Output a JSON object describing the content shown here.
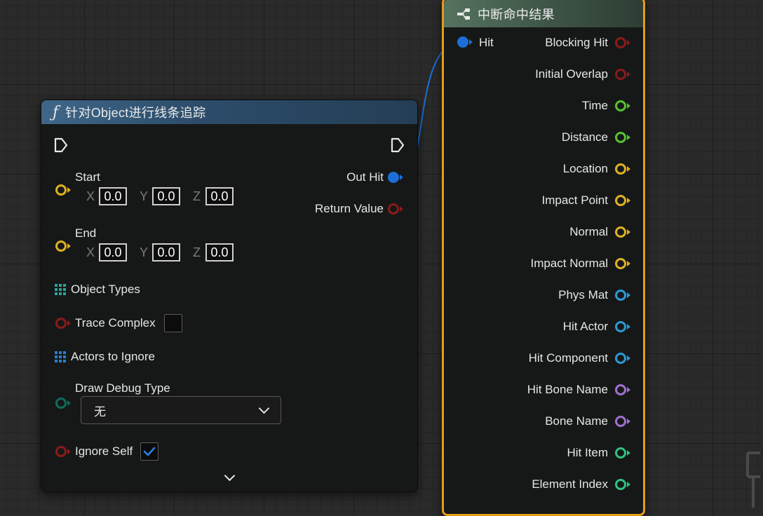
{
  "trace_node": {
    "icon": "function-icon",
    "icon_glyph": "ƒ",
    "title": "针对Object进行线条追踪",
    "pins": {
      "start": {
        "label": "Start",
        "x": "0.0",
        "y": "0.0",
        "z": "0.0",
        "color": "#e0b020"
      },
      "end": {
        "label": "End",
        "x": "0.0",
        "y": "0.0",
        "z": "0.0",
        "color": "#e0b020"
      },
      "object_types": {
        "label": "Object Types",
        "color": "#2aa39a"
      },
      "trace_complex": {
        "label": "Trace Complex",
        "checked": false,
        "color": "#8c1a1a"
      },
      "actors_to_ignore": {
        "label": "Actors to Ignore",
        "color": "#2a7fcf"
      },
      "draw_debug_type": {
        "label": "Draw Debug Type",
        "selected": "无",
        "color": "#0e6d5a"
      },
      "ignore_self": {
        "label": "Ignore Self",
        "checked": true,
        "color": "#8c1a1a"
      },
      "out_hit": {
        "label": "Out Hit",
        "color": "#1c6fd6"
      },
      "return_value": {
        "label": "Return Value",
        "color": "#8c1a1a"
      }
    },
    "axis_labels": {
      "x": "X",
      "y": "Y",
      "z": "Z"
    }
  },
  "break_node": {
    "icon": "break-struct-icon",
    "title": "中断命中结果",
    "input": {
      "label": "Hit",
      "color": "#1c6fd6"
    },
    "outputs": [
      {
        "label": "Blocking Hit",
        "color": "#8c1a1a"
      },
      {
        "label": "Initial Overlap",
        "color": "#8c1a1a"
      },
      {
        "label": "Time",
        "color": "#57c22e"
      },
      {
        "label": "Distance",
        "color": "#57c22e"
      },
      {
        "label": "Location",
        "color": "#e0b020"
      },
      {
        "label": "Impact Point",
        "color": "#e0b020"
      },
      {
        "label": "Normal",
        "color": "#e0b020"
      },
      {
        "label": "Impact Normal",
        "color": "#e0b020"
      },
      {
        "label": "Phys Mat",
        "color": "#2a9ad6"
      },
      {
        "label": "Hit Actor",
        "color": "#2a9ad6"
      },
      {
        "label": "Hit Component",
        "color": "#2a9ad6"
      },
      {
        "label": "Hit Bone Name",
        "color": "#a070d0"
      },
      {
        "label": "Bone Name",
        "color": "#a070d0"
      },
      {
        "label": "Hit Item",
        "color": "#30c080"
      },
      {
        "label": "Element Index",
        "color": "#30c080"
      }
    ]
  },
  "colors": {
    "wire": "#1c6fd6",
    "selection_border": "#e59b19",
    "checkmark": "#2a7fe0"
  }
}
